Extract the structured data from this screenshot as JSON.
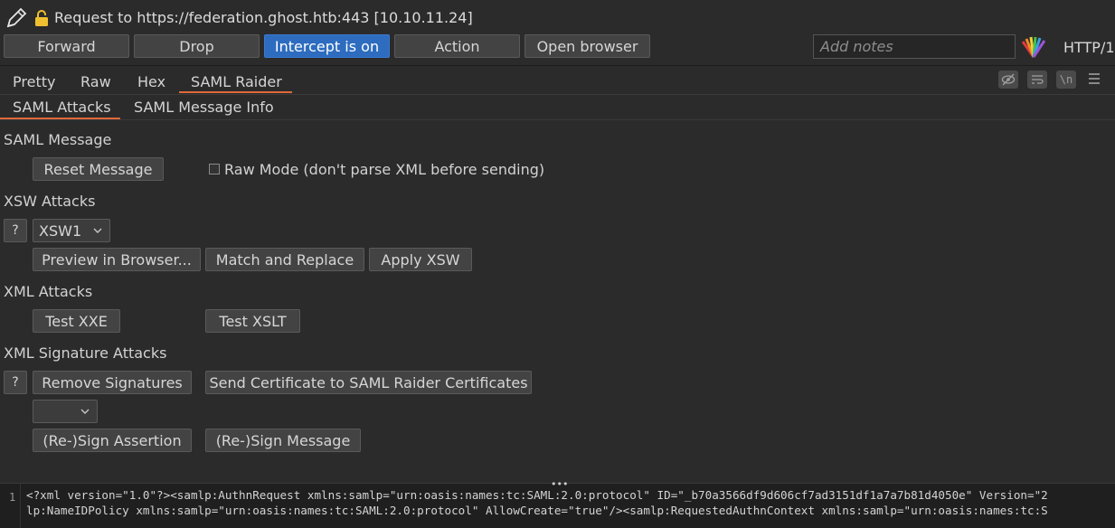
{
  "header": {
    "title": "Request to https://federation.ghost.htb:443  [10.10.11.24]"
  },
  "toolbar": {
    "forward": "Forward",
    "drop": "Drop",
    "intercept": "Intercept is on",
    "action": "Action",
    "open_browser": "Open browser",
    "notes_placeholder": "Add notes",
    "http_label": "HTTP/1"
  },
  "view_tabs": [
    "Pretty",
    "Raw",
    "Hex",
    "SAML Raider"
  ],
  "view_tools": {
    "wrap_icon": "\\n"
  },
  "sub_tabs": [
    "SAML Attacks",
    "SAML Message Info"
  ],
  "saml_message": {
    "heading": "SAML Message",
    "reset_button": "Reset Message",
    "raw_mode_label": "Raw Mode (don't parse XML before sending)"
  },
  "xsw": {
    "heading": "XSW Attacks",
    "help": "?",
    "selected": "XSW1",
    "preview": "Preview in Browser...",
    "match_replace": "Match and Replace",
    "apply": "Apply XSW"
  },
  "xml_attacks": {
    "heading": "XML Attacks",
    "xxe": "Test XXE",
    "xslt": "Test XSLT"
  },
  "signature": {
    "heading": "XML Signature Attacks",
    "help": "?",
    "remove": "Remove Signatures",
    "send_cert": "Send Certificate to SAML Raider Certificates",
    "selected": "",
    "sign_assertion": "(Re-)Sign Assertion",
    "sign_message": "(Re-)Sign Message"
  },
  "editor": {
    "line_number": "1",
    "lines": [
      "<?xml version=\"1.0\"?><samlp:AuthnRequest xmlns:samlp=\"urn:oasis:names:tc:SAML:2.0:protocol\" ID=\"_b70a3566df9d606cf7ad3151df1a7a7b81d4050e\" Version=\"2",
      "lp:NameIDPolicy xmlns:samlp=\"urn:oasis:names:tc:SAML:2.0:protocol\" AllowCreate=\"true\"/><samlp:RequestedAuthnContext xmlns:samlp=\"urn:oasis:names:tc:S"
    ]
  },
  "colors": {
    "accent": "#2d6cbf",
    "tab_underline": "#e0683a",
    "background": "#2b2b2b"
  }
}
